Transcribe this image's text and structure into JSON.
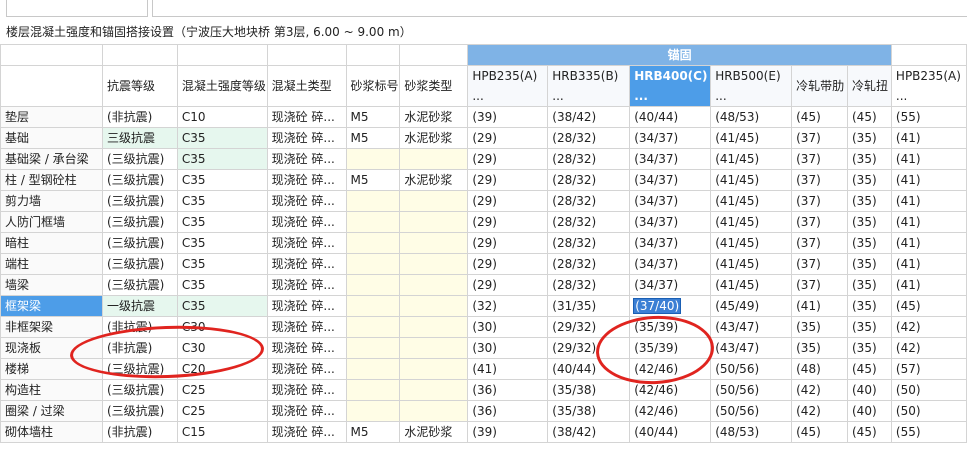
{
  "caption": "楼层混凝土强度和锚固搭接设置（宁波压大地块桥   第3层, 6.00 ~ 9.00 m）",
  "group_header": "锚固",
  "columns": [
    {
      "label": "",
      "type": "row"
    },
    {
      "label": "抗震等级"
    },
    {
      "label": "混凝土强度等级"
    },
    {
      "label": "混凝土类型"
    },
    {
      "label": "砂浆标号"
    },
    {
      "label": "砂浆类型"
    },
    {
      "label": "HPB235(A)\n..."
    },
    {
      "label": "HRB335(B)\n..."
    },
    {
      "label": "HRB400(C)\n...",
      "selected": true
    },
    {
      "label": "HRB500(E)\n..."
    },
    {
      "label": "冷轧带肋"
    },
    {
      "label": "冷轧扭"
    },
    {
      "label": "HPB235(A)\n..."
    }
  ],
  "rows": [
    {
      "name": "垫层",
      "seismic": "(非抗震)",
      "strength": "C10",
      "ctype": "现浇砼 碎...",
      "mortar": "M5",
      "mtype": "水泥砂浆",
      "a": "(39)",
      "b": "(38/42)",
      "c": "(40/44)",
      "e": "(48/53)",
      "lz": "(45)",
      "ln": "(45)",
      "a2": "(55)"
    },
    {
      "name": "基础",
      "seismic": "三级抗震",
      "strength": "C35",
      "ctype": "现浇砼 碎...",
      "mortar": "M5",
      "mtype": "水泥砂浆",
      "a": "(29)",
      "b": "(28/32)",
      "c": "(34/37)",
      "e": "(41/45)",
      "lz": "(37)",
      "ln": "(35)",
      "a2": "(41)",
      "green": true
    },
    {
      "name": "基础梁 / 承台梁",
      "seismic": "(三级抗震)",
      "strength": "C35",
      "ctype": "现浇砼 碎...",
      "mortar": "",
      "mtype": "",
      "a": "(29)",
      "b": "(28/32)",
      "c": "(34/37)",
      "e": "(41/45)",
      "lz": "(37)",
      "ln": "(35)",
      "a2": "(41)",
      "green_strength": true
    },
    {
      "name": "柱 / 型钢砼柱",
      "seismic": "(三级抗震)",
      "strength": "C35",
      "ctype": "现浇砼 碎...",
      "mortar": "M5",
      "mtype": "水泥砂浆",
      "a": "(29)",
      "b": "(28/32)",
      "c": "(34/37)",
      "e": "(41/45)",
      "lz": "(37)",
      "ln": "(35)",
      "a2": "(41)"
    },
    {
      "name": "剪力墙",
      "seismic": "(三级抗震)",
      "strength": "C35",
      "ctype": "现浇砼 碎...",
      "mortar": "",
      "mtype": "",
      "a": "(29)",
      "b": "(28/32)",
      "c": "(34/37)",
      "e": "(41/45)",
      "lz": "(37)",
      "ln": "(35)",
      "a2": "(41)"
    },
    {
      "name": "人防门框墙",
      "seismic": "(三级抗震)",
      "strength": "C35",
      "ctype": "现浇砼 碎...",
      "mortar": "",
      "mtype": "",
      "a": "(29)",
      "b": "(28/32)",
      "c": "(34/37)",
      "e": "(41/45)",
      "lz": "(37)",
      "ln": "(35)",
      "a2": "(41)"
    },
    {
      "name": "暗柱",
      "seismic": "(三级抗震)",
      "strength": "C35",
      "ctype": "现浇砼 碎...",
      "mortar": "",
      "mtype": "",
      "a": "(29)",
      "b": "(28/32)",
      "c": "(34/37)",
      "e": "(41/45)",
      "lz": "(37)",
      "ln": "(35)",
      "a2": "(41)"
    },
    {
      "name": "端柱",
      "seismic": "(三级抗震)",
      "strength": "C35",
      "ctype": "现浇砼 碎...",
      "mortar": "",
      "mtype": "",
      "a": "(29)",
      "b": "(28/32)",
      "c": "(34/37)",
      "e": "(41/45)",
      "lz": "(37)",
      "ln": "(35)",
      "a2": "(41)"
    },
    {
      "name": "墙梁",
      "seismic": "(三级抗震)",
      "strength": "C35",
      "ctype": "现浇砼 碎...",
      "mortar": "",
      "mtype": "",
      "a": "(29)",
      "b": "(28/32)",
      "c": "(34/37)",
      "e": "(41/45)",
      "lz": "(37)",
      "ln": "(35)",
      "a2": "(41)"
    },
    {
      "name": "框架梁",
      "seismic": "一级抗震",
      "strength": "C35",
      "ctype": "现浇砼 碎...",
      "mortar": "",
      "mtype": "",
      "a": "(32)",
      "b": "(31/35)",
      "c": "(37/40)",
      "e": "(45/49)",
      "lz": "(41)",
      "ln": "(35)",
      "a2": "(45)",
      "green": true,
      "selected": true
    },
    {
      "name": "非框架梁",
      "seismic": "(非抗震)",
      "strength": "C30",
      "ctype": "现浇砼 碎...",
      "mortar": "",
      "mtype": "",
      "a": "(30)",
      "b": "(29/32)",
      "c": "(35/39)",
      "e": "(43/47)",
      "lz": "(35)",
      "ln": "(35)",
      "a2": "(42)"
    },
    {
      "name": "现浇板",
      "seismic": "(非抗震)",
      "strength": "C30",
      "ctype": "现浇砼 碎...",
      "mortar": "",
      "mtype": "",
      "a": "(30)",
      "b": "(29/32)",
      "c": "(35/39)",
      "e": "(43/47)",
      "lz": "(35)",
      "ln": "(35)",
      "a2": "(42)"
    },
    {
      "name": "楼梯",
      "seismic": "(三级抗震)",
      "strength": "C20",
      "ctype": "现浇砼 碎...",
      "mortar": "",
      "mtype": "",
      "a": "(41)",
      "b": "(40/44)",
      "c": "(42/46)",
      "e": "(50/56)",
      "lz": "(48)",
      "ln": "(45)",
      "a2": "(57)"
    },
    {
      "name": "构造柱",
      "seismic": "(三级抗震)",
      "strength": "C25",
      "ctype": "现浇砼 碎...",
      "mortar": "",
      "mtype": "",
      "a": "(36)",
      "b": "(35/38)",
      "c": "(42/46)",
      "e": "(50/56)",
      "lz": "(42)",
      "ln": "(40)",
      "a2": "(50)"
    },
    {
      "name": "圈梁 / 过梁",
      "seismic": "(三级抗震)",
      "strength": "C25",
      "ctype": "现浇砼 碎...",
      "mortar": "",
      "mtype": "",
      "a": "(36)",
      "b": "(35/38)",
      "c": "(42/46)",
      "e": "(50/56)",
      "lz": "(42)",
      "ln": "(40)",
      "a2": "(50)"
    },
    {
      "name": "砌体墙柱",
      "seismic": "(非抗震)",
      "strength": "C15",
      "ctype": "现浇砼 碎...",
      "mortar": "M5",
      "mtype": "水泥砂浆",
      "a": "(39)",
      "b": "(38/42)",
      "c": "(40/44)",
      "e": "(48/53)",
      "lz": "(45)",
      "ln": "(45)",
      "a2": "(55)"
    }
  ]
}
